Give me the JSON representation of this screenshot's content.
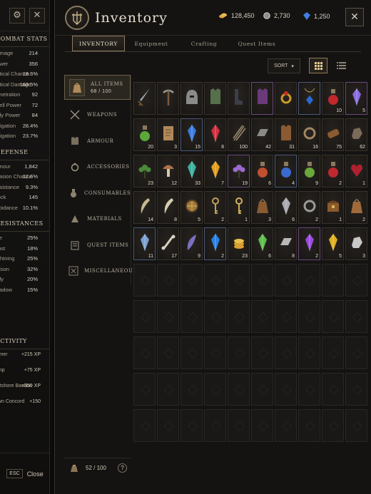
{
  "stats_panel": {
    "combat_header": "COMBAT STATS",
    "combat_stats": [
      {
        "label": "Damage",
        "value": "214"
      },
      {
        "label": "Power",
        "value": "356"
      },
      {
        "label": "Critical Chance",
        "value": "18.6%"
      },
      {
        "label": "Critical Damage",
        "value": "168.5%"
      },
      {
        "label": "Penetration",
        "value": "92"
      },
      {
        "label": "Spell Power",
        "value": "72"
      },
      {
        "label": "Holy Power",
        "value": "84"
      },
      {
        "label": "Mitigation",
        "value": "28.4%"
      },
      {
        "label": "Mitigation",
        "value": "23.7%"
      }
    ],
    "defense_header": "DEFENSE",
    "defense_stats": [
      {
        "label": "Armour",
        "value": "1,842"
      },
      {
        "label": "Evasion Chance",
        "value": "12.6%"
      },
      {
        "label": "Resistance",
        "value": "9.3%"
      },
      {
        "label": "Block",
        "value": "145"
      },
      {
        "label": "Avoidance",
        "value": "10.1%"
      }
    ],
    "resist_header": "RESISTANCES",
    "resist_stats": [
      {
        "label": "Fire",
        "value": "25%"
      },
      {
        "label": "Frost",
        "value": "18%"
      },
      {
        "label": "Lightning",
        "value": "25%"
      },
      {
        "label": "Poison",
        "value": "32%"
      },
      {
        "label": "Holy",
        "value": "20%"
      },
      {
        "label": "Shadow",
        "value": "15%"
      }
    ],
    "activity_header": "ACTIVITY",
    "activity": [
      {
        "label": "Farmer",
        "value": "+215 XP"
      },
      {
        "label": "Camp",
        "value": "+75 XP"
      },
      {
        "label": "Eastshore Bastion",
        "value": "+350 XP"
      },
      {
        "label": "Dawn Concord",
        "value": "+150"
      }
    ],
    "esc_key": "ESC",
    "close_label": "Close"
  },
  "window": {
    "title": "Inventory",
    "currencies": [
      {
        "icon": "gold-coins-icon",
        "value": "128,450",
        "color": "#d9a441"
      },
      {
        "icon": "silver-coin-icon",
        "value": "2,730",
        "color": "#a9a9a9"
      },
      {
        "icon": "blue-gem-icon",
        "value": "1,250",
        "color": "#3f7fe0"
      }
    ],
    "close_icon": "close-icon"
  },
  "tabs": [
    {
      "label": "Inventory",
      "active": true
    },
    {
      "label": "Equipment",
      "active": false
    },
    {
      "label": "Crafting",
      "active": false
    },
    {
      "label": "Quest Items",
      "active": false
    }
  ],
  "toolbar": {
    "sort_label": "Sort"
  },
  "categories": [
    {
      "label": "All Items",
      "count": "68 / 100",
      "icon": "bag-icon",
      "active": true
    },
    {
      "label": "Weapons",
      "icon": "crossed-swords-icon"
    },
    {
      "label": "Armour",
      "icon": "armour-icon"
    },
    {
      "label": "Accessories",
      "icon": "ring-icon"
    },
    {
      "label": "Consumables",
      "icon": "potion-icon"
    },
    {
      "label": "Materials",
      "icon": "materials-icon"
    },
    {
      "label": "Quest Items",
      "icon": "scroll-icon"
    },
    {
      "label": "Miscellaneous",
      "icon": "misc-icon"
    }
  ],
  "capacity": {
    "value": "52 / 100"
  },
  "items": [
    {
      "icon": "sword-icon",
      "qty": "",
      "color": "#9aa3ad"
    },
    {
      "icon": "pickaxe-icon",
      "qty": "",
      "color": "#7c5a3e"
    },
    {
      "icon": "helmet-icon",
      "qty": "",
      "color": "#8a8a8a"
    },
    {
      "icon": "chest-armor-icon",
      "qty": "",
      "color": "#55704a"
    },
    {
      "icon": "boots-icon",
      "qty": "",
      "color": "#3a3f4a"
    },
    {
      "icon": "cloak-icon",
      "qty": "",
      "color": "#6a3a7a"
    },
    {
      "icon": "ring-icon",
      "qty": "",
      "color": "#c89a2a"
    },
    {
      "icon": "amulet-icon",
      "qty": "",
      "color": "#2a6ad0"
    },
    {
      "icon": "red-potion-icon",
      "qty": "10",
      "color": "#c0282c"
    },
    {
      "icon": "purple-crystal-icon",
      "qty": "5",
      "color": "#8a6ae0"
    },
    {
      "icon": "green-potion-icon",
      "qty": "20",
      "color": "#5aa83a"
    },
    {
      "icon": "scroll-map-icon",
      "qty": "3",
      "color": "#b08a5a"
    },
    {
      "icon": "blue-crystal-icon",
      "qty": "15",
      "color": "#3a7ae0"
    },
    {
      "icon": "red-crystal-icon",
      "qty": "8",
      "color": "#d03040"
    },
    {
      "icon": "arrows-icon",
      "qty": "100",
      "color": "#9a8a70"
    },
    {
      "icon": "iron-ingot-icon",
      "qty": "42",
      "color": "#8a8a88"
    },
    {
      "icon": "leather-icon",
      "qty": "31",
      "color": "#8a5a32"
    },
    {
      "icon": "rope-icon",
      "qty": "16",
      "color": "#a08560"
    },
    {
      "icon": "wood-log-icon",
      "qty": "75",
      "color": "#8a5a30"
    },
    {
      "icon": "ore-icon",
      "qty": "62",
      "color": "#7a6a5a"
    },
    {
      "icon": "herb-icon",
      "qty": "23",
      "color": "#4a8a3a"
    },
    {
      "icon": "mushroom-icon",
      "qty": "12",
      "color": "#b0704a"
    },
    {
      "icon": "teal-crystal-icon",
      "qty": "33",
      "color": "#3ab0a0"
    },
    {
      "icon": "amber-crystal-icon",
      "qty": "7",
      "color": "#e0a020"
    },
    {
      "icon": "purple-flower-icon",
      "qty": "19",
      "color": "#9a6ad0"
    },
    {
      "icon": "flask-icon",
      "qty": "6",
      "color": "#c05030"
    },
    {
      "icon": "blue-potion-icon",
      "qty": "4",
      "color": "#3a6ad0"
    },
    {
      "icon": "green-flask-icon",
      "qty": "9",
      "color": "#6aa83a"
    },
    {
      "icon": "red-flask-icon",
      "qty": "2",
      "color": "#c02830"
    },
    {
      "icon": "heart-icon",
      "qty": "1",
      "color": "#b02030"
    },
    {
      "icon": "horn-icon",
      "qty": "14",
      "color": "#c8b890"
    },
    {
      "icon": "fang-icon",
      "qty": "8",
      "color": "#d8ccb0"
    },
    {
      "icon": "shield-icon",
      "qty": "5",
      "color": "#a07a3a"
    },
    {
      "icon": "key-icon",
      "qty": "2",
      "color": "#c0a060"
    },
    {
      "icon": "gold-key-icon",
      "qty": "1",
      "color": "#d0b060"
    },
    {
      "icon": "pouch-icon",
      "qty": "3",
      "color": "#8a5a30"
    },
    {
      "icon": "crystal-cluster-icon",
      "qty": "6",
      "color": "#a8a8b0"
    },
    {
      "icon": "horseshoe-icon",
      "qty": "2",
      "color": "#9a9a98"
    },
    {
      "icon": "chest-icon",
      "qty": "1",
      "color": "#8a5a2a"
    },
    {
      "icon": "sack-icon",
      "qty": "2",
      "color": "#a06a3a"
    },
    {
      "icon": "blue-shard-icon",
      "qty": "11",
      "color": "#7aa0d0"
    },
    {
      "icon": "bone-icon",
      "qty": "17",
      "color": "#d8d0c0"
    },
    {
      "icon": "feather-icon",
      "qty": "9",
      "color": "#7a70c0"
    },
    {
      "icon": "mana-crystal-icon",
      "qty": "2",
      "color": "#2a80e0"
    },
    {
      "icon": "gold-coin-stack-icon",
      "qty": "23",
      "color": "#d8a030"
    },
    {
      "icon": "emerald-icon",
      "qty": "6",
      "color": "#5ac04a"
    },
    {
      "icon": "silver-bar-icon",
      "qty": "8",
      "color": "#b8b8b8"
    },
    {
      "icon": "amethyst-icon",
      "qty": "2",
      "color": "#9a4ae0"
    },
    {
      "icon": "topaz-icon",
      "qty": "5",
      "color": "#e0b020"
    },
    {
      "icon": "rune-stone-icon",
      "qty": "3",
      "color": "#c8c8c8"
    }
  ],
  "total_slots": 100
}
